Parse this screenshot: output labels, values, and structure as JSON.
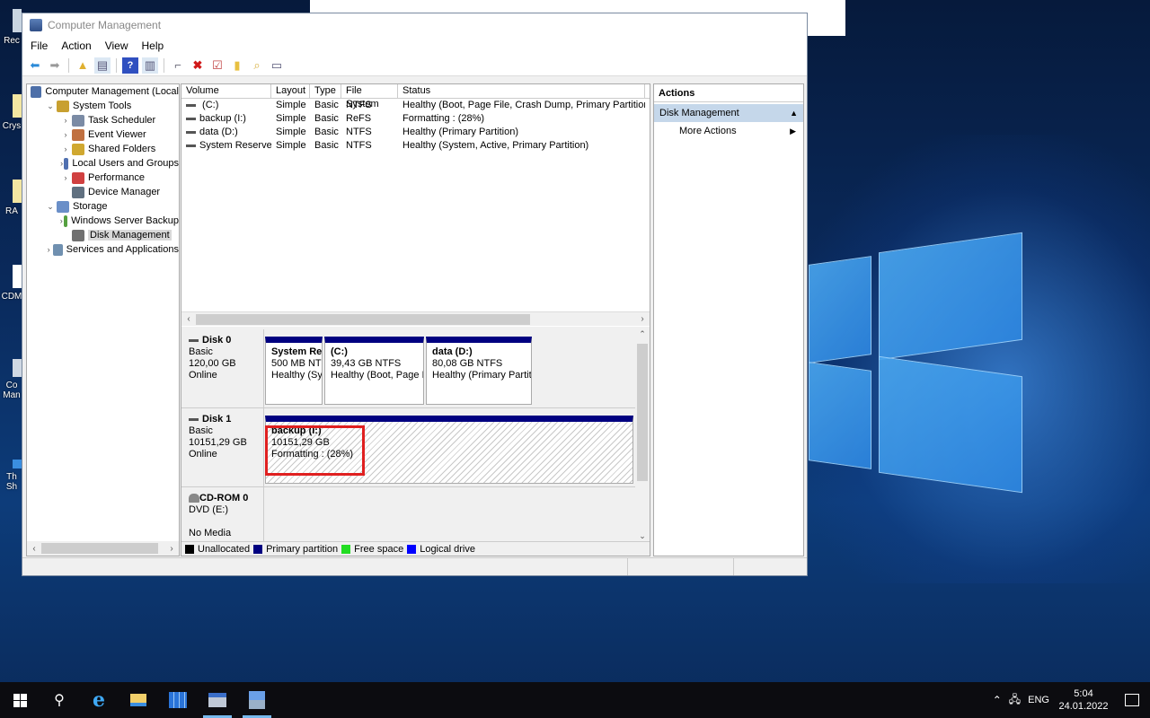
{
  "desktop": {
    "icons": [
      "Rec",
      "Crys",
      "RA",
      "CDM",
      "Co Man",
      "Th Sh"
    ]
  },
  "window": {
    "title": "Computer Management",
    "menu": [
      "File",
      "Action",
      "View",
      "Help"
    ],
    "toolbar_icons": [
      "back-icon",
      "forward-icon",
      "up-folder-icon",
      "show-hide-tree-icon",
      "help-icon",
      "show-action-pane-icon",
      "connect-icon",
      "delete-icon",
      "properties-icon",
      "folder-up-icon",
      "search-folder-icon",
      "view-list-icon"
    ]
  },
  "tree": {
    "items": [
      {
        "label": "Computer Management (Local",
        "level": 0,
        "chev": ""
      },
      {
        "label": "System Tools",
        "level": 1,
        "chev": "⌄"
      },
      {
        "label": "Task Scheduler",
        "level": 2,
        "chev": "›"
      },
      {
        "label": "Event Viewer",
        "level": 2,
        "chev": "›"
      },
      {
        "label": "Shared Folders",
        "level": 2,
        "chev": "›"
      },
      {
        "label": "Local Users and Groups",
        "level": 2,
        "chev": "›"
      },
      {
        "label": "Performance",
        "level": 2,
        "chev": "›"
      },
      {
        "label": "Device Manager",
        "level": 2,
        "chev": ""
      },
      {
        "label": "Storage",
        "level": 1,
        "chev": "⌄"
      },
      {
        "label": "Windows Server Backup",
        "level": 2,
        "chev": "›"
      },
      {
        "label": "Disk Management",
        "level": 2,
        "chev": "",
        "selected": true
      },
      {
        "label": "Services and Applications",
        "level": 1,
        "chev": "›"
      }
    ]
  },
  "volumes": {
    "columns": [
      "Volume",
      "Layout",
      "Type",
      "File System",
      "Status"
    ],
    "rows": [
      {
        "volume": " (C:)",
        "layout": "Simple",
        "type": "Basic",
        "fs": "NTFS",
        "status": "Healthy (Boot, Page File, Crash Dump, Primary Partition)"
      },
      {
        "volume": "backup (I:)",
        "layout": "Simple",
        "type": "Basic",
        "fs": "ReFS",
        "status": "Formatting : (28%)"
      },
      {
        "volume": "data (D:)",
        "layout": "Simple",
        "type": "Basic",
        "fs": "NTFS",
        "status": "Healthy (Primary Partition)"
      },
      {
        "volume": "System Reserved",
        "layout": "Simple",
        "type": "Basic",
        "fs": "NTFS",
        "status": "Healthy (System, Active, Primary Partition)"
      }
    ]
  },
  "disks": [
    {
      "name": "Disk 0",
      "type": "Basic",
      "size": "120,00 GB",
      "state": "Online",
      "partitions": [
        {
          "title": "System Re",
          "line2": "500 MB NT",
          "line3": "Healthy (Sy"
        },
        {
          "title": "(C:)",
          "line2": "39,43 GB NTFS",
          "line3": "Healthy (Boot, Page I"
        },
        {
          "title": "data  (D:)",
          "line2": "80,08 GB NTFS",
          "line3": "Healthy (Primary Partit"
        }
      ]
    },
    {
      "name": "Disk 1",
      "type": "Basic",
      "size": "10151,29 GB",
      "state": "Online",
      "partitions": [
        {
          "title": "backup  (I:)",
          "line2": "10151,29 GB",
          "line3": "Formatting : (28%)"
        }
      ]
    },
    {
      "name": "CD-ROM 0",
      "type": "DVD (E:)",
      "size": "",
      "state": "No Media",
      "partitions": []
    }
  ],
  "legend": [
    {
      "label": "Unallocated",
      "color": "#000000"
    },
    {
      "label": "Primary partition",
      "color": "#000080"
    },
    {
      "label": "Free space",
      "color": "#22dd22"
    },
    {
      "label": "Logical drive",
      "color": "#0000ff"
    }
  ],
  "actions": {
    "header": "Actions",
    "section": "Disk Management",
    "items": [
      "More Actions"
    ]
  },
  "taskbar": {
    "tray_lang": "ENG",
    "time": "5:04",
    "date": "24.01.2022"
  }
}
